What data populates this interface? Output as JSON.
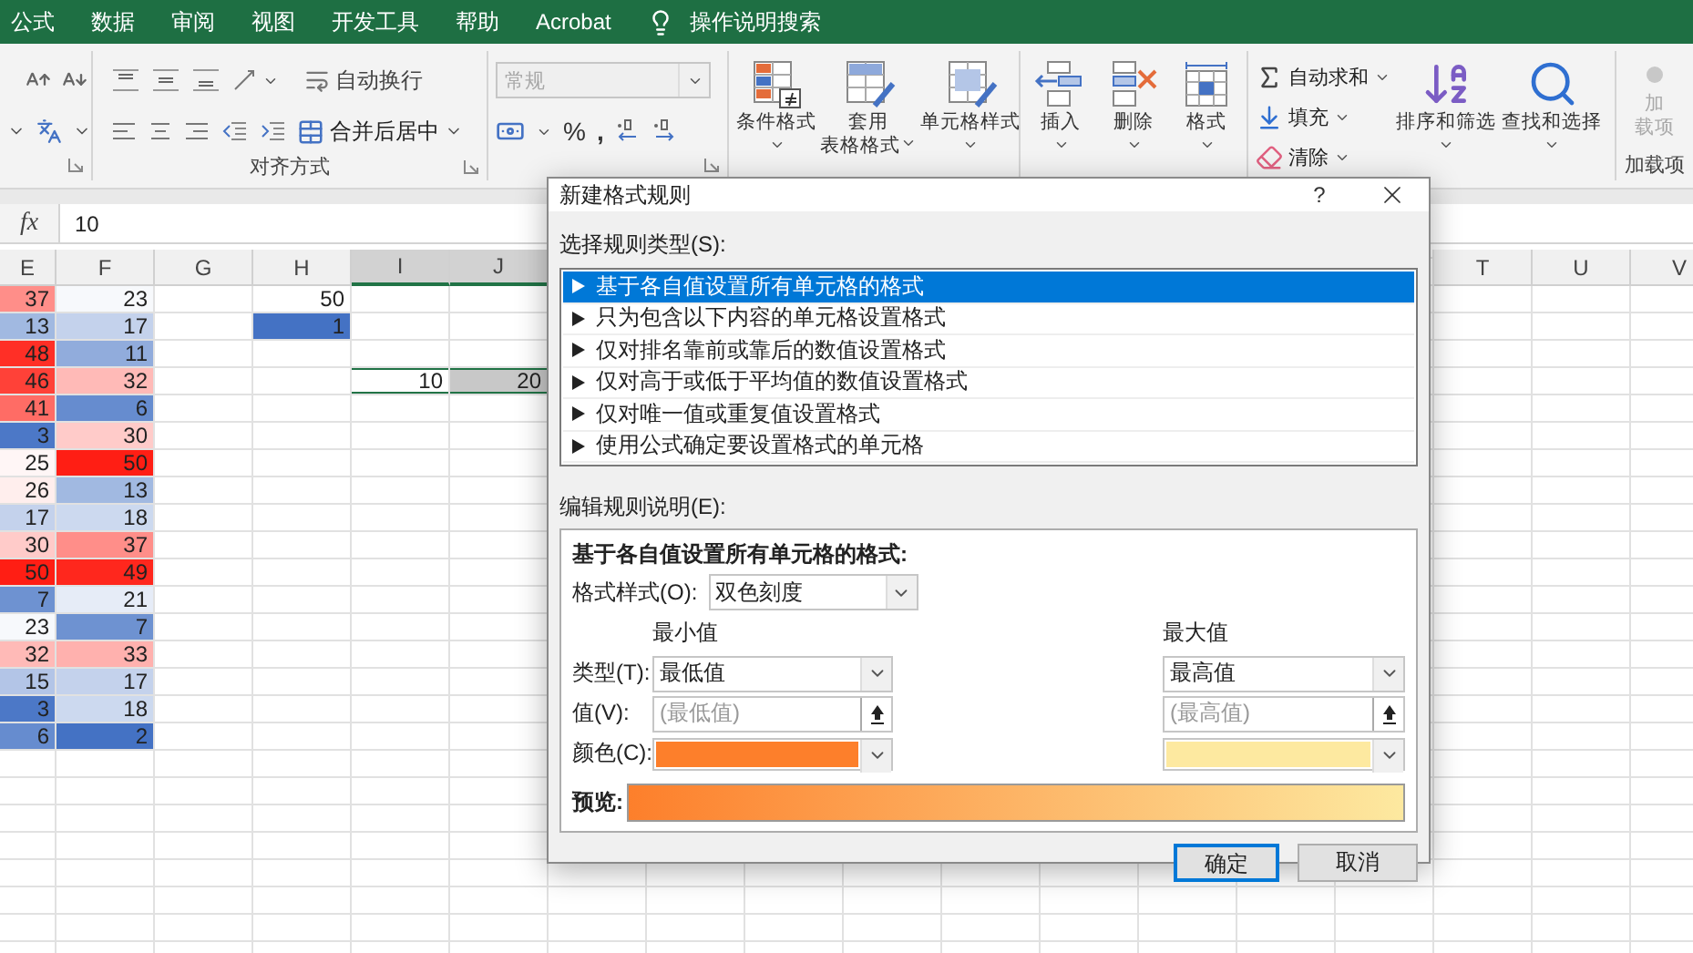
{
  "menu": {
    "tabs": [
      "公式",
      "数据",
      "审阅",
      "视图",
      "开发工具",
      "帮助",
      "Acrobat"
    ],
    "search": "操作说明搜索"
  },
  "ribbon": {
    "alignment": {
      "wrap": "自动换行",
      "merge": "合并后居中",
      "label": "对齐方式"
    },
    "number": {
      "format": "常规",
      "format_disabled": true,
      "percent": "%",
      "comma": ","
    },
    "styles": {
      "buttons": [
        {
          "lines": [
            "条件格式"
          ],
          "kind": "conditional"
        },
        {
          "lines": [
            "套用",
            "表格格式"
          ],
          "kind": "table"
        },
        {
          "lines": [
            "单元格样式"
          ],
          "kind": "cellstyle"
        }
      ]
    },
    "cells": {
      "buttons": [
        {
          "lines": [
            "插入"
          ],
          "kind": "insert"
        },
        {
          "lines": [
            "删除"
          ],
          "kind": "delete"
        },
        {
          "lines": [
            "格式"
          ],
          "kind": "format"
        }
      ]
    },
    "editing": {
      "small": [
        {
          "label": "自动求和",
          "kind": "sum"
        },
        {
          "label": "填充",
          "kind": "fill"
        },
        {
          "label": "清除",
          "kind": "eraser"
        }
      ],
      "big": [
        {
          "lines": [
            "排序和筛选"
          ],
          "kind": "sort"
        },
        {
          "lines": [
            "查找和选择"
          ],
          "kind": "search"
        }
      ]
    },
    "addins": {
      "lines": [
        "加",
        "载项"
      ],
      "disabled": true,
      "label": "加载项"
    }
  },
  "formula_bar": {
    "function_label": "fx",
    "value": "10"
  },
  "sheet": {
    "columns": [
      {
        "label": "E",
        "selected": false
      },
      {
        "label": "F",
        "selected": false
      },
      {
        "label": "G",
        "selected": false
      },
      {
        "label": "H",
        "selected": false
      },
      {
        "label": "I",
        "selected": true
      },
      {
        "label": "J",
        "selected": true
      },
      {
        "label": "T",
        "selected": false
      },
      {
        "label": "U",
        "selected": false
      },
      {
        "label": "V",
        "selected": false
      }
    ],
    "rows": [
      {
        "cells": [
          {
            "text": "37",
            "color": "#ff8e89",
            "selected": false
          },
          {
            "text": "23",
            "color": "#f7f9fc",
            "selected": false
          }
        ],
        "cell_h": {
          "text": "50",
          "selected": false
        }
      },
      {
        "cells": [
          {
            "text": "13",
            "color": "#a1b9e1",
            "selected": false
          },
          {
            "text": "17",
            "color": "#c4d2ec",
            "selected": false
          }
        ],
        "cell_h": {
          "text": "1",
          "color": "#4472c4",
          "selected": false
        }
      },
      {
        "cells": [
          {
            "text": "48",
            "color": "#ff2f26",
            "selected": false
          },
          {
            "text": "11",
            "color": "#91acdc",
            "selected": false
          }
        ]
      },
      {
        "cells": [
          {
            "text": "46",
            "color": "#ff4138",
            "selected": false
          },
          {
            "text": "32",
            "color": "#ffbab7",
            "selected": false
          }
        ],
        "cells_i_j": [
          {
            "text": "10",
            "selected": true,
            "active": true
          },
          {
            "text": "20",
            "selected": true,
            "active": false
          }
        ]
      },
      {
        "cells": [
          {
            "text": "41",
            "color": "#ff6c65",
            "selected": false
          },
          {
            "text": "6",
            "color": "#668ccf",
            "selected": false
          }
        ]
      },
      {
        "cells": [
          {
            "text": "3",
            "color": "#4c78c7",
            "selected": false
          },
          {
            "text": "30",
            "color": "#ffcbc9",
            "selected": false
          }
        ]
      },
      {
        "cells": [
          {
            "text": "25",
            "color": "#fff6f6",
            "selected": false
          },
          {
            "text": "50",
            "color": "#ff1e14",
            "selected": false
          }
        ]
      },
      {
        "cells": [
          {
            "text": "26",
            "color": "#ffeeed",
            "selected": false
          },
          {
            "text": "13",
            "color": "#a1b9e1",
            "selected": false
          }
        ]
      },
      {
        "cells": [
          {
            "text": "17",
            "color": "#c4d2ec",
            "selected": false
          },
          {
            "text": "18",
            "color": "#ccd9ef",
            "selected": false
          }
        ]
      },
      {
        "cells": [
          {
            "text": "30",
            "color": "#ffcbc9",
            "selected": false
          },
          {
            "text": "37",
            "color": "#ff8e89",
            "selected": false
          }
        ]
      },
      {
        "cells": [
          {
            "text": "50",
            "color": "#ff1e14",
            "selected": false
          },
          {
            "text": "49",
            "color": "#ff271d",
            "selected": false
          }
        ]
      },
      {
        "cells": [
          {
            "text": "7",
            "color": "#6e92d1",
            "selected": false
          },
          {
            "text": "21",
            "color": "#e6ecf7",
            "selected": false
          }
        ]
      },
      {
        "cells": [
          {
            "text": "23",
            "color": "#f7f9fc",
            "selected": false
          },
          {
            "text": "7",
            "color": "#6e92d1",
            "selected": false
          }
        ]
      },
      {
        "cells": [
          {
            "text": "32",
            "color": "#ffbab7",
            "selected": false
          },
          {
            "text": "33",
            "color": "#ffb1ae",
            "selected": false
          }
        ]
      },
      {
        "cells": [
          {
            "text": "15",
            "color": "#b3c5e7",
            "selected": false
          },
          {
            "text": "17",
            "color": "#c4d2ec",
            "selected": false
          }
        ]
      },
      {
        "cells": [
          {
            "text": "3",
            "color": "#4c78c7",
            "selected": false
          },
          {
            "text": "18",
            "color": "#ccd9ef",
            "selected": false
          }
        ]
      },
      {
        "cells": [
          {
            "text": "6",
            "color": "#668ccf",
            "selected": false
          },
          {
            "text": "2",
            "color": "#4472c4",
            "selected": false
          }
        ]
      }
    ]
  },
  "dialog": {
    "title": "新建格式规则",
    "help": "?",
    "rule_type_label": "选择规则类型(S):",
    "rule_types": [
      {
        "text": "基于各自值设置所有单元格的格式",
        "selected": true
      },
      {
        "text": "只为包含以下内容的单元格设置格式",
        "selected": false
      },
      {
        "text": "仅对排名靠前或靠后的数值设置格式",
        "selected": false
      },
      {
        "text": "仅对高于或低于平均值的数值设置格式",
        "selected": false
      },
      {
        "text": "仅对唯一值或重复值设置格式",
        "selected": false
      },
      {
        "text": "使用公式确定要设置格式的单元格",
        "selected": false
      }
    ],
    "edit_label": "编辑规则说明(E):",
    "description": {
      "heading": "基于各自值设置所有单元格的格式:",
      "style_label": "格式样式(O):",
      "style_value": "双色刻度",
      "type_label": "类型(T):",
      "value_label": "值(V):",
      "color_label": "颜色(C):",
      "preview_label": "预览:",
      "min": {
        "heading": "最小值",
        "type": "最低值",
        "value_placeholder": "(最低值)",
        "color": "#fd7f2b"
      },
      "max": {
        "heading": "最大值",
        "type": "最高值",
        "value_placeholder": "(最高值)",
        "color": "#fde9a0"
      }
    },
    "buttons": [
      {
        "label": "确定",
        "default": true
      },
      {
        "label": "取消",
        "default": false
      }
    ]
  }
}
